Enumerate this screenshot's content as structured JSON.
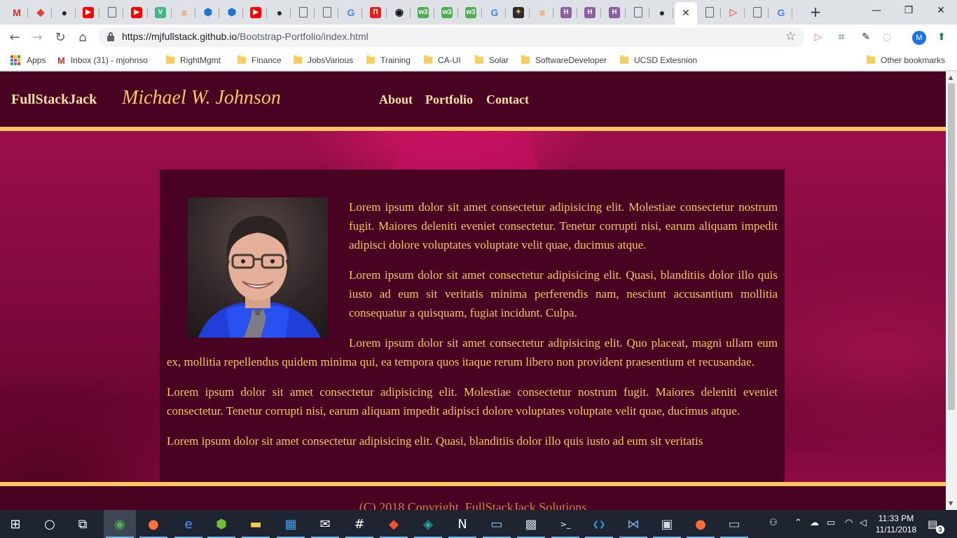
{
  "browser": {
    "tabs": [
      {
        "icon": "gmail-icon",
        "glyph": "M",
        "color": "#d93025",
        "bg": "transparent"
      },
      {
        "icon": "gitlab-icon",
        "glyph": "◆",
        "color": "#e24329",
        "bg": "transparent"
      },
      {
        "icon": "github-icon",
        "glyph": "●",
        "color": "#24292e",
        "bg": "transparent"
      },
      {
        "icon": "youtube-icon",
        "glyph": "▶",
        "color": "#ffffff",
        "bg": "#ff0000"
      },
      {
        "icon": "page-icon",
        "glyph": "",
        "color": "#5f6368",
        "bg": "transparent"
      },
      {
        "icon": "youtube-icon",
        "glyph": "▶",
        "color": "#ffffff",
        "bg": "#ff0000"
      },
      {
        "icon": "vuejs-icon",
        "glyph": "V",
        "color": "#ffffff",
        "bg": "#41b883"
      },
      {
        "icon": "stackoverflow-icon",
        "glyph": "≡",
        "color": "#f48024",
        "bg": "transparent"
      },
      {
        "icon": "cube-icon",
        "glyph": "⬢",
        "color": "#1976d2",
        "bg": "transparent"
      },
      {
        "icon": "cube-icon",
        "glyph": "⬢",
        "color": "#1976d2",
        "bg": "transparent"
      },
      {
        "icon": "youtube-icon",
        "glyph": "▶",
        "color": "#ffffff",
        "bg": "#ff0000"
      },
      {
        "icon": "github-icon",
        "glyph": "●",
        "color": "#24292e",
        "bg": "transparent"
      },
      {
        "icon": "page-icon",
        "glyph": "",
        "color": "#5f6368",
        "bg": "transparent"
      },
      {
        "icon": "page-icon",
        "glyph": "",
        "color": "#5f6368",
        "bg": "transparent"
      },
      {
        "icon": "google-icon",
        "glyph": "G",
        "color": "#4285f4",
        "bg": "transparent"
      },
      {
        "icon": "notion-icon",
        "glyph": "П",
        "color": "#ffffff",
        "bg": "#e2231a"
      },
      {
        "icon": "circle-icon",
        "glyph": "◉",
        "color": "#111111",
        "bg": "transparent"
      },
      {
        "icon": "w3schools-icon",
        "glyph": "w3",
        "color": "#ffffff",
        "bg": "#4caf50"
      },
      {
        "icon": "w3schools-icon",
        "glyph": "w3",
        "color": "#ffffff",
        "bg": "#4caf50"
      },
      {
        "icon": "w3schools-icon",
        "glyph": "w3",
        "color": "#ffffff",
        "bg": "#4caf50"
      },
      {
        "icon": "google-icon",
        "glyph": "G",
        "color": "#4285f4",
        "bg": "transparent"
      },
      {
        "icon": "codepen-icon",
        "glyph": "✦",
        "color": "#f7c948",
        "bg": "#2d2d2d"
      },
      {
        "icon": "stackoverflow-icon",
        "glyph": "≡",
        "color": "#f48024",
        "bg": "transparent"
      },
      {
        "icon": "hackerrank-icon",
        "glyph": "H",
        "color": "#ffffff",
        "bg": "#8e5ea2"
      },
      {
        "icon": "hackerrank-icon",
        "glyph": "H",
        "color": "#ffffff",
        "bg": "#8e5ea2"
      },
      {
        "icon": "hackerrank-icon",
        "glyph": "H",
        "color": "#ffffff",
        "bg": "#8e5ea2"
      },
      {
        "icon": "page-icon",
        "glyph": "",
        "color": "#5f6368",
        "bg": "transparent"
      },
      {
        "icon": "github-icon",
        "glyph": "●",
        "color": "#24292e",
        "bg": "transparent"
      },
      {
        "icon": "close-icon",
        "glyph": "✕",
        "color": "#333333",
        "bg": "transparent",
        "active": true
      },
      {
        "icon": "page-icon",
        "glyph": "",
        "color": "#5f6368",
        "bg": "transparent"
      },
      {
        "icon": "play-icon",
        "glyph": "▷",
        "color": "#f76f6f",
        "bg": "transparent"
      },
      {
        "icon": "page-icon",
        "glyph": "",
        "color": "#5f6368",
        "bg": "transparent"
      },
      {
        "icon": "google-icon",
        "glyph": "G",
        "color": "#4285f4",
        "bg": "transparent"
      }
    ],
    "new_tab": "+",
    "window": {
      "minimize": "—",
      "maximize": "❐",
      "close": "✕"
    },
    "nav": {
      "back": "←",
      "forward": "→",
      "reload": "↻",
      "home": "⌂"
    },
    "url_host": "https://mjfullstack.github.io",
    "url_path": "/Bootstrap-Portfolio/index.html",
    "star": "☆",
    "profile_initial": "M",
    "bookmarks": [
      {
        "label": "Apps",
        "kind": "apps"
      },
      {
        "label": "Inbox (31) - mjohnso",
        "kind": "gmail"
      },
      {
        "label": "RightMgmt",
        "kind": "folder"
      },
      {
        "label": "Finance",
        "kind": "folder"
      },
      {
        "label": "JobsVarious",
        "kind": "folder"
      },
      {
        "label": "Training",
        "kind": "folder"
      },
      {
        "label": "CA-UI",
        "kind": "folder"
      },
      {
        "label": "Solar",
        "kind": "folder"
      },
      {
        "label": "SoftwareDeveloper",
        "kind": "folder"
      },
      {
        "label": "UCSD Extesnion",
        "kind": "folder"
      },
      {
        "label": "Other bookmarks",
        "kind": "folder"
      }
    ]
  },
  "site": {
    "brand": "FullStackJack",
    "name": "Michael W. Johnson",
    "nav": [
      "About",
      "Portfolio",
      "Contact"
    ],
    "paragraphs": [
      "Lorem ipsum dolor sit amet consectetur adipisicing elit. Molestiae consectetur nostrum fugit. Maiores deleniti eveniet consectetur. Tenetur corrupti nisi, earum aliquam impedit adipisci dolore voluptates voluptate velit quae, ducimus atque.",
      "Lorem ipsum dolor sit amet consectetur adipisicing elit. Quasi, blanditiis dolor illo quis iusto ad eum sit veritatis minima perferendis nam, nesciunt accusantium mollitia consequatur a quisquam, fugiat incidunt. Culpa.",
      "Lorem ipsum dolor sit amet consectetur adipisicing elit. Quo placeat, magni ullam eum ex, mollitia repellendus quidem minima qui, ea tempora quos itaque rerum libero non provident praesentium et recusandae.",
      "Lorem ipsum dolor sit amet consectetur adipisicing elit. Molestiae consectetur nostrum fugit. Maiores deleniti eveniet consectetur. Tenetur corrupti nisi, earum aliquam impedit adipisci dolore voluptates voluptate velit quae, ducimus atque.",
      "Lorem ipsum dolor sit amet consectetur adipisicing elit. Quasi, blanditiis dolor illo quis iusto ad eum sit veritatis"
    ],
    "footer": "(C) 2018 Copyright, FullStackJack Solutions",
    "colors": {
      "maroon": "#4a0223",
      "gold": "#fbc561",
      "cream": "#fde2a8",
      "magenta": "#d81469"
    }
  },
  "taskbar": {
    "apps": [
      {
        "icon": "windows-start-icon",
        "glyph": "⊞",
        "color": "#ffffff"
      },
      {
        "icon": "cortana-icon",
        "glyph": "○",
        "color": "#ffffff"
      },
      {
        "icon": "task-view-icon",
        "glyph": "⧉",
        "color": "#ffffff"
      },
      {
        "icon": "chrome-icon",
        "glyph": "◉",
        "color": "#4caf50"
      },
      {
        "icon": "firefox-icon",
        "glyph": "●",
        "color": "#ff7139"
      },
      {
        "icon": "edge-icon",
        "glyph": "e",
        "color": "#3b9bff"
      },
      {
        "icon": "shield-icon",
        "glyph": "⬢",
        "color": "#6fbf3a"
      },
      {
        "icon": "file-explorer-icon",
        "glyph": "▬",
        "color": "#f8c94c"
      },
      {
        "icon": "store-icon",
        "glyph": "▦",
        "color": "#3aa0f3"
      },
      {
        "icon": "mail-icon",
        "glyph": "✉",
        "color": "#ffffff"
      },
      {
        "icon": "slack-icon",
        "glyph": "#",
        "color": "#ffffff"
      },
      {
        "icon": "brave-icon",
        "glyph": "◆",
        "color": "#fb542b"
      },
      {
        "icon": "gitkraken-icon",
        "glyph": "◈",
        "color": "#23b0a0"
      },
      {
        "icon": "onenote-icon",
        "glyph": "N",
        "color": "#ffffff"
      },
      {
        "icon": "remote-desktop-icon",
        "glyph": "▭",
        "color": "#8fc6f0"
      },
      {
        "icon": "photos-icon",
        "glyph": "▩",
        "color": "#c9d4e0"
      },
      {
        "icon": "terminal-icon",
        "glyph": ">_",
        "color": "#ffffff"
      },
      {
        "icon": "vscode-icon",
        "glyph": "❮❯",
        "color": "#2ea4f2"
      },
      {
        "icon": "mysql-icon",
        "glyph": "⋈",
        "color": "#6fa8dc"
      },
      {
        "icon": "mysql-shell-icon",
        "glyph": "▣",
        "color": "#cfd8dc"
      },
      {
        "icon": "postman-icon",
        "glyph": "●",
        "color": "#ff6c37"
      },
      {
        "icon": "desktop-icon",
        "glyph": "▭",
        "color": "#b0bec5"
      }
    ],
    "time": "11:33 PM",
    "date": "11/11/2018",
    "notification_count": "3"
  }
}
